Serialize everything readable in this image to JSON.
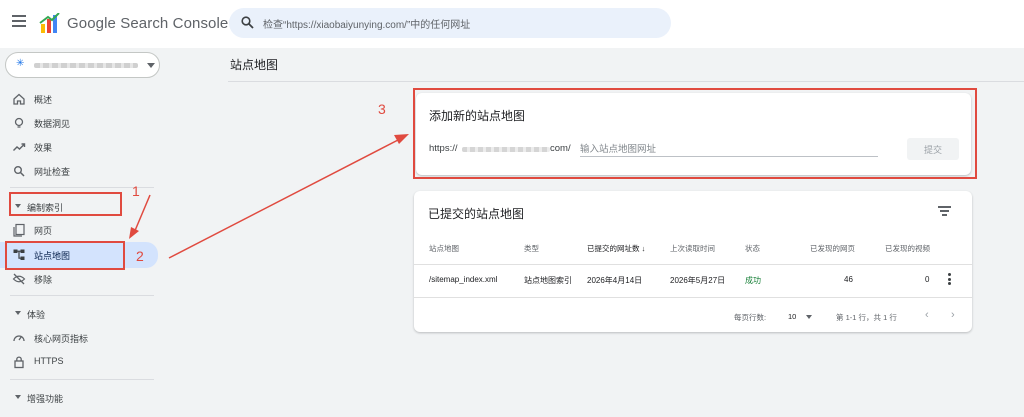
{
  "header": {
    "app_title": "Google Search Console",
    "search_placeholder": "检查“https://xiaobaiyunying.com/”中的任何网址"
  },
  "property_selector": {
    "icon": "sparkle-icon"
  },
  "sidebar": {
    "top_items": [
      {
        "label": "概述",
        "icon": "home-icon"
      },
      {
        "label": "数据洞见",
        "icon": "lightbulb-icon"
      },
      {
        "label": "效果",
        "icon": "trending-icon"
      },
      {
        "label": "网址检查",
        "icon": "search-icon"
      }
    ],
    "sections": [
      {
        "title": "编制索引",
        "items": [
          "网页",
          "站点地图",
          "移除"
        ]
      },
      {
        "title": "体验",
        "items": [
          "核心网页指标",
          "HTTPS"
        ]
      },
      {
        "title": "增强功能",
        "items": []
      }
    ]
  },
  "page": {
    "title": "站点地图"
  },
  "add_sitemap": {
    "title": "添加新的站点地图",
    "url_prefix": "https://",
    "url_suffix": "com/",
    "input_placeholder": "输入站点地图网址",
    "submit_label": "提交"
  },
  "submitted": {
    "title": "已提交的站点地图",
    "columns": [
      "站点地图",
      "类型",
      "已提交的网址数",
      "上次读取时间",
      "状态",
      "已发现的网页",
      "已发现的视频"
    ],
    "sort_arrow": "↓",
    "rows": [
      {
        "sitemap": "/sitemap_index.xml",
        "type": "站点地图索引",
        "submitted": "2026年4月14日",
        "last_read": "2026年5月27日",
        "status": "成功",
        "pages": "46",
        "videos": "0"
      }
    ],
    "footer": {
      "rows_per_page_label": "每页行数:",
      "rows_per_page": "10",
      "range": "第 1-1 行，共 1 行"
    }
  },
  "annotations": {
    "label_1": "1",
    "label_2": "2",
    "label_3": "3",
    "color": "#e04a3f"
  },
  "colors": {
    "accent": "#1a73e8",
    "success": "#188038",
    "active_nav": "#d3e3fd"
  }
}
